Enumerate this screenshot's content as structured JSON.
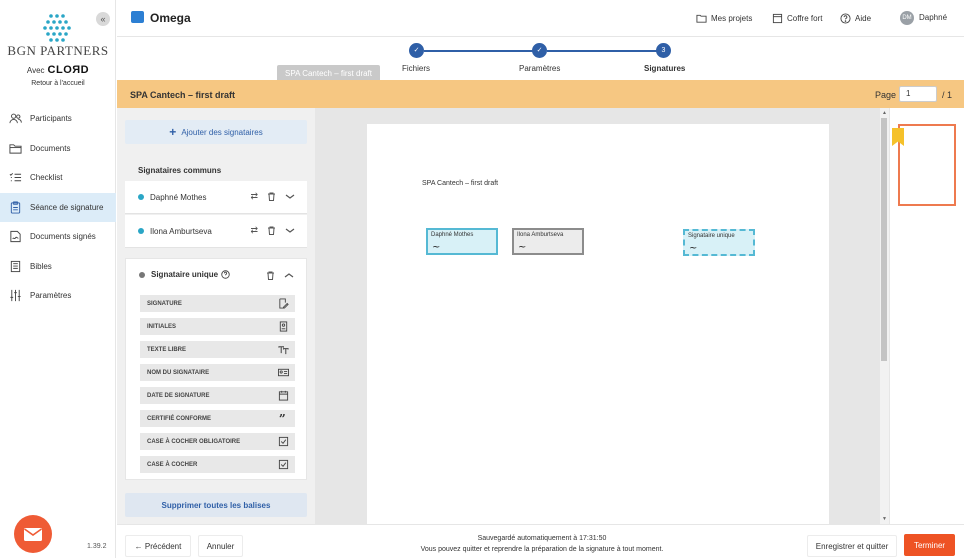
{
  "brand": {
    "name": "BGN PARTNERS",
    "avec": "Avec",
    "partner": "CLOЯD",
    "back": "Retour à l'accueil"
  },
  "sidebar": {
    "collapse": "«",
    "items": [
      {
        "label": "Participants",
        "icon": "users-icon"
      },
      {
        "label": "Documents",
        "icon": "folder-icon"
      },
      {
        "label": "Checklist",
        "icon": "checklist-icon"
      },
      {
        "label": "Séance de signature",
        "icon": "clipboard-icon"
      },
      {
        "label": "Documents signés",
        "icon": "signed-doc-icon"
      },
      {
        "label": "Bibles",
        "icon": "book-icon"
      },
      {
        "label": "Paramètres",
        "icon": "sliders-icon"
      }
    ],
    "version": "1.39.2"
  },
  "header": {
    "project": "Omega",
    "links": [
      "Mes projets",
      "Coffre fort",
      "Aide"
    ],
    "user_initials": "DM",
    "user_name": "Daphné"
  },
  "stepper": {
    "steps": [
      {
        "label": "Fichiers",
        "state": "done"
      },
      {
        "label": "Paramètres",
        "state": "done"
      },
      {
        "label": "Signatures",
        "state": "current",
        "number": "3"
      }
    ],
    "tooltip": "SPA Cantech – first draft"
  },
  "titlebar": {
    "title": "SPA Cantech – first draft",
    "page_label": "Page",
    "page_value": "1",
    "page_total": "/ 1"
  },
  "panel": {
    "add_button": "Ajouter des signataires",
    "common_title": "Signataires communs",
    "common": [
      "Daphné Mothes",
      "Ilona Amburtseva"
    ],
    "unique_title": "Signataire unique",
    "tags": [
      {
        "label": "SIGNATURE",
        "icon": "signature-icon"
      },
      {
        "label": "INITIALES",
        "icon": "initials-icon"
      },
      {
        "label": "TEXTE LIBRE",
        "icon": "text-icon"
      },
      {
        "label": "NOM DU SIGNATAIRE",
        "icon": "id-card-icon"
      },
      {
        "label": "DATE DE SIGNATURE",
        "icon": "calendar-icon"
      },
      {
        "label": "CERTIFIÉ CONFORME",
        "icon": "quote-icon"
      },
      {
        "label": "CASE À COCHER OBLIGATOIRE",
        "icon": "checkbox-icon"
      },
      {
        "label": "CASE À COCHER",
        "icon": "checkbox-icon"
      }
    ],
    "delete_all": "Supprimer toutes les balises"
  },
  "document": {
    "heading": "SPA Cantech – first draft",
    "fields": [
      "Daphné Mothes",
      "Ilona Amburtseva",
      "Signataire unique"
    ]
  },
  "footer": {
    "previous": "← Précédent",
    "cancel": "Annuler",
    "autosave_line1": "Sauvegardé automatiquement à 17:31:50",
    "autosave_line2": "Vous pouvez quitter et reprendre la préparation de la signature à tout moment.",
    "save_quit": "Enregistrer et quitter",
    "finish": "Terminer"
  },
  "colors": {
    "accent": "#2f5fa7",
    "titlebar": "#f6c782",
    "finish": "#ee5324",
    "signer": "#2aa6c6"
  }
}
